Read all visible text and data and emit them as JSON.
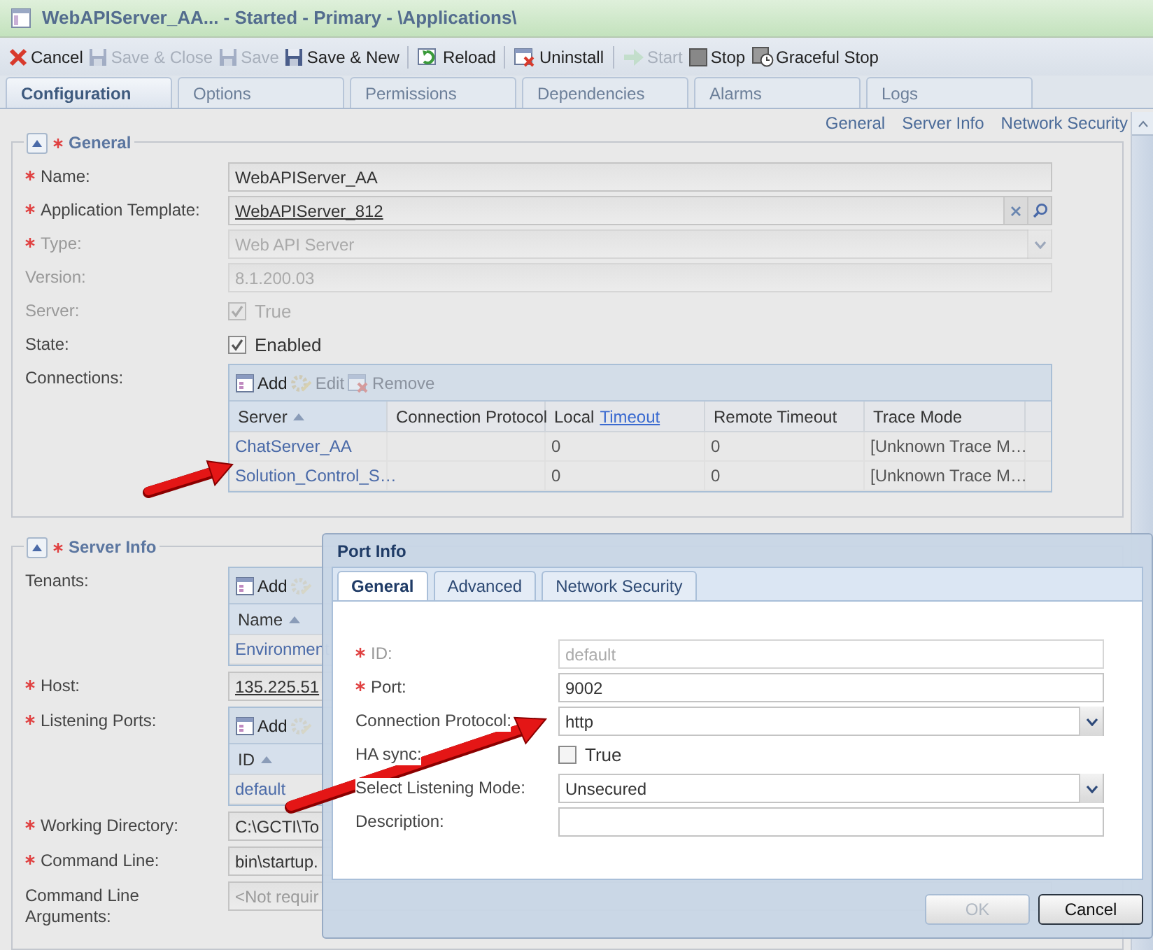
{
  "window": {
    "title": "WebAPIServer_AA... - Started - Primary - \\Applications\\"
  },
  "toolbar_groups": [
    [
      {
        "label": "Cancel",
        "disabled": false
      },
      {
        "label": "Save & Close",
        "disabled": true
      },
      {
        "label": "Save",
        "disabled": true
      },
      {
        "label": "Save & New",
        "disabled": false
      }
    ],
    [
      {
        "label": "Reload",
        "disabled": false
      }
    ],
    [
      {
        "label": "Uninstall",
        "disabled": false
      }
    ],
    [
      {
        "label": "Start",
        "disabled": true
      },
      {
        "label": "Stop",
        "disabled": false
      },
      {
        "label": "Graceful Stop",
        "disabled": false
      }
    ]
  ],
  "tabs": [
    {
      "label": "Configuration",
      "selected": true
    },
    {
      "label": "Options",
      "selected": false
    },
    {
      "label": "Permissions",
      "selected": false
    },
    {
      "label": "Dependencies",
      "selected": false
    },
    {
      "label": "Alarms",
      "selected": false
    },
    {
      "label": "Logs",
      "selected": false
    }
  ],
  "section_links": [
    "General",
    "Server Info",
    "Network Security"
  ],
  "sections": [
    {
      "title": "General",
      "required": true,
      "fields": [
        {
          "kind": "text",
          "label": "Name:",
          "required": true,
          "disabled": false,
          "value": "WebAPIServer_AA"
        },
        {
          "kind": "lookup",
          "label": "Application Template:",
          "required": true,
          "disabled": false,
          "value": "WebAPIServer_812"
        },
        {
          "kind": "select",
          "label": "Type:",
          "required": true,
          "disabled": true,
          "value": "Web API Server"
        },
        {
          "kind": "text",
          "label": "Version:",
          "required": false,
          "disabled": true,
          "value": "8.1.200.03"
        },
        {
          "kind": "checkbox",
          "label": "Server:",
          "required": false,
          "disabled": true,
          "checked": true,
          "text": "True"
        },
        {
          "kind": "checkbox",
          "label": "State:",
          "required": false,
          "disabled": false,
          "checked": true,
          "text": "Enabled"
        },
        {
          "kind": "table",
          "label": "Connections:",
          "required": false,
          "actions": [
            {
              "label": "Add",
              "disabled": false
            },
            {
              "label": "Edit",
              "disabled": true
            },
            {
              "label": "Remove",
              "disabled": true
            }
          ],
          "columns": [
            {
              "label": "Server",
              "sorted": true
            },
            {
              "label": "Connection Protocol",
              "sorted": false
            },
            {
              "label": "Local",
              "link": "Timeout",
              "sorted": false
            },
            {
              "label": "Remote Timeout",
              "sorted": false
            },
            {
              "label": "Trace Mode",
              "sorted": false
            }
          ],
          "rows": [
            [
              "ChatServer_AA",
              null,
              "0",
              "0",
              "[Unknown Trace M…"
            ],
            [
              "Solution_Control_S…",
              null,
              "0",
              "0",
              "[Unknown Trace M…"
            ]
          ]
        }
      ]
    },
    {
      "title": "Server Info",
      "required": true,
      "fields": [
        {
          "kind": "table",
          "label": "Tenants:",
          "required": false,
          "actions": [
            {
              "label": "Add",
              "disabled": false
            },
            {
              "disabled": true
            }
          ],
          "columns": [
            {
              "label": "Name",
              "sorted": true
            }
          ],
          "rows": [
            [
              "Environment"
            ]
          ]
        },
        {
          "kind": "link",
          "label": "Host:",
          "required": true,
          "disabled": false,
          "value": "135.225.51"
        },
        {
          "kind": "table",
          "label": "Listening Ports:",
          "required": true,
          "actions": [
            {
              "label": "Add",
              "disabled": false
            },
            {
              "disabled": true
            }
          ],
          "columns": [
            {
              "label": "ID",
              "sorted": true
            }
          ],
          "rows": [
            [
              "default"
            ]
          ]
        },
        {
          "kind": "text",
          "label": "Working Directory:",
          "required": true,
          "disabled": false,
          "value": "C:\\GCTI\\To"
        },
        {
          "kind": "text",
          "label": "Command Line:",
          "required": true,
          "disabled": false,
          "value": "bin\\startup."
        },
        {
          "kind": "text",
          "label": "Command Line Arguments:",
          "required": false,
          "disabled": false,
          "placeholder": "<Not requir"
        }
      ]
    }
  ],
  "dialog": {
    "title": "Port Info",
    "tabs": [
      {
        "label": "General",
        "selected": true
      },
      {
        "label": "Advanced",
        "selected": false
      },
      {
        "label": "Network Security",
        "selected": false
      }
    ],
    "fields": [
      {
        "kind": "text",
        "label": "ID:",
        "required": true,
        "disabled": true,
        "value": "default"
      },
      {
        "kind": "text",
        "label": "Port:",
        "required": true,
        "disabled": false,
        "value": "9002"
      },
      {
        "kind": "select",
        "label": "Connection Protocol:",
        "required": false,
        "disabled": false,
        "value": "http"
      },
      {
        "kind": "checkbox",
        "label": "HA sync:",
        "required": false,
        "disabled": false,
        "checked": false,
        "text": "True"
      },
      {
        "kind": "select",
        "label": "Select Listening Mode:",
        "required": false,
        "disabled": false,
        "value": "Unsecured"
      },
      {
        "kind": "text",
        "label": "Description:",
        "required": false,
        "disabled": false
      }
    ],
    "buttons": [
      {
        "label": "OK",
        "disabled": true
      },
      {
        "label": "Cancel",
        "disabled": false
      }
    ]
  }
}
